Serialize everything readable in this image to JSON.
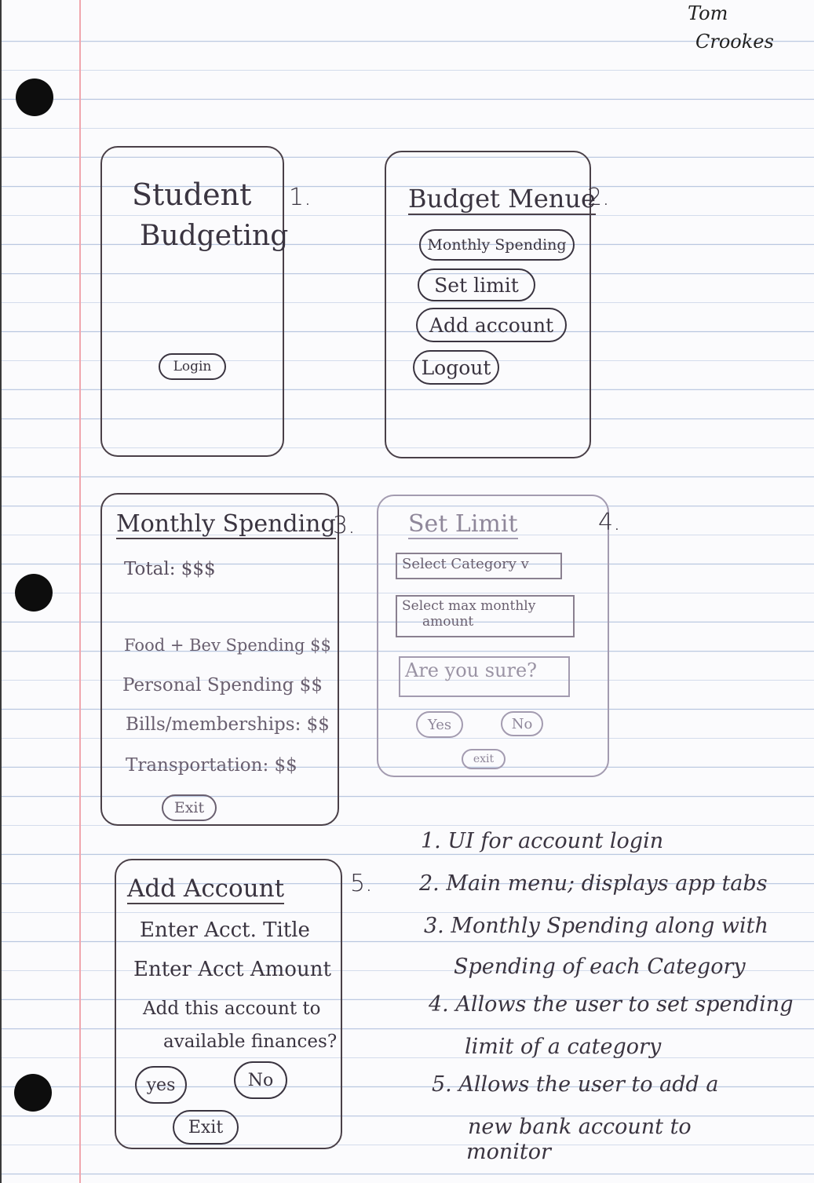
{
  "author": {
    "line1": "Tom",
    "line2": "Crookes"
  },
  "screens": {
    "s1": {
      "number": "1.",
      "title_line1": "Student",
      "title_line2": "Budgeting",
      "login_button": "Login"
    },
    "s2": {
      "number": "2.",
      "title": "Budget Menue",
      "buttons": [
        "Monthly Spending",
        "Set limit",
        "Add account",
        "Logout"
      ]
    },
    "s3": {
      "number": "3.",
      "title": "Monthly Spending",
      "total": "Total: $$$",
      "rows": [
        "Food + Bev Spending $$",
        "Personal Spending $$",
        "Bills/memberships: $$",
        "Transportation: $$"
      ],
      "exit_button": "Exit"
    },
    "s4": {
      "number": "4.",
      "title": "Set Limit",
      "category_select": "Select Category v",
      "amount_box_line1": "Select max monthly",
      "amount_box_line2": "amount",
      "confirm_text": "Are you sure?",
      "yes_button": "Yes",
      "no_button": "No",
      "exit_button": "exit"
    },
    "s5": {
      "number": "5.",
      "title": "Add Account",
      "field_title": "Enter Acct. Title",
      "field_amount": "Enter Acct Amount",
      "question_line1": "Add this account to",
      "question_line2": "available finances?",
      "yes_button": "yes",
      "no_button": "No",
      "exit_button": "Exit"
    }
  },
  "notes": [
    "1. UI for account login",
    "2. Main menu; displays app tabs",
    "3. Monthly Spending along with",
    "Spending of each Category",
    "4. Allows the user to set spending",
    "limit of a category",
    "5. Allows the user to add a",
    "new bank account to",
    "monitor"
  ]
}
